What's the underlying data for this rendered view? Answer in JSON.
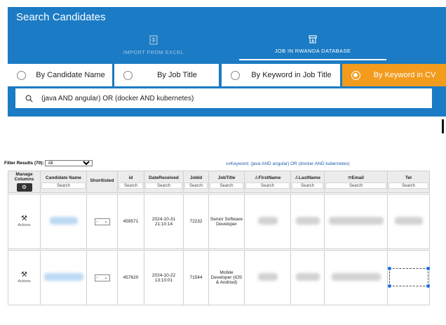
{
  "panel": {
    "title": "Search Candidates",
    "tabs": [
      {
        "label": "IMPORT FROM EXCEL",
        "icon": "excel-file-icon",
        "active": false
      },
      {
        "label": "JOB IN RWANDA DATABASE",
        "icon": "database-archive-icon",
        "active": true
      }
    ],
    "options": [
      {
        "label": "By Candidate Name",
        "selected": false
      },
      {
        "label": "By Job Title",
        "selected": false
      },
      {
        "label": "By Keyword in Job Title",
        "selected": false
      },
      {
        "label": "By Keyword in CV",
        "selected": true
      }
    ],
    "search_value": "(java AND angular) OR (docker AND kubernetes)",
    "colors": {
      "panel": "#1b7bc4",
      "selected": "#f29b1d"
    }
  },
  "filter": {
    "label": "Filter Results (70):",
    "select_value": "All",
    "cv_keyword": "cvKeyword: (java AND angular) OR (docker AND kubernetes)"
  },
  "table": {
    "columns": [
      {
        "label": "Manage Columns"
      },
      {
        "label": "Candidate Name",
        "search": "Search"
      },
      {
        "label": "Shortlisted"
      },
      {
        "label": "id",
        "search": "Search"
      },
      {
        "label": "DateReceived",
        "search": "Search"
      },
      {
        "label": "JobId",
        "search": "Search"
      },
      {
        "label": "JobTitle",
        "search": "Search"
      },
      {
        "label": "FirstName",
        "search": "Search"
      },
      {
        "label": "LastName",
        "search": "Search"
      },
      {
        "label": "Email",
        "search": "Search"
      },
      {
        "label": "Tel",
        "search": "Search"
      }
    ],
    "actions_label": "Actions",
    "shortlist_value": "-",
    "rows": [
      {
        "id": "459571",
        "date": "2024-10-31 21:10:14",
        "jobid": "72232",
        "jobtitle": "Senior Software Developer"
      },
      {
        "id": "457620",
        "date": "2024-10-22 13:10:01",
        "jobid": "71544",
        "jobtitle": "Mobile Developer (iOS & Andriod)"
      }
    ]
  }
}
